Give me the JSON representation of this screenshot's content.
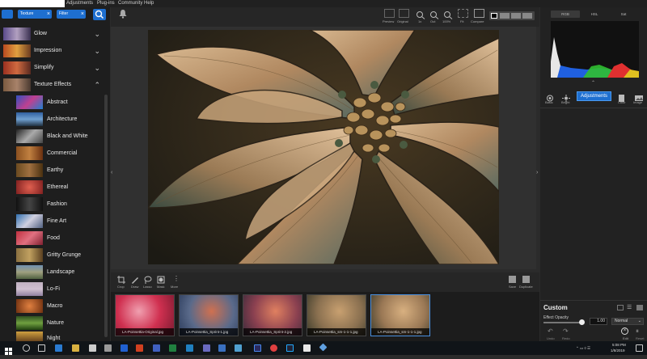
{
  "menubar": {
    "items": [
      "Adjustments",
      "Plug-ins",
      "Community",
      "Help"
    ]
  },
  "search": {
    "chips": [
      "Texture",
      "Filter"
    ]
  },
  "categories": [
    {
      "label": "Glow",
      "expanded": false
    },
    {
      "label": "Impression",
      "expanded": false
    },
    {
      "label": "Simplify",
      "expanded": false
    },
    {
      "label": "Texture Effects",
      "expanded": true
    }
  ],
  "presets": [
    "Abstract",
    "Architecture",
    "Black and White",
    "Commercial",
    "Earthy",
    "Ethereal",
    "Fashion",
    "Fine Art",
    "Food",
    "Gritty Grunge",
    "Landscape",
    "Lo-Fi",
    "Macro",
    "Nature",
    "Night"
  ],
  "toolbar": {
    "buttons": [
      "Preview",
      "Original",
      "1x",
      "Out",
      "100%",
      "Fit",
      "Compare",
      "Overlay"
    ],
    "left_bell": "bell"
  },
  "filmtools": {
    "left": [
      "Crop",
      "Draw",
      "Lasso",
      "Mask",
      "More"
    ],
    "right": [
      "Save",
      "Duplicate"
    ]
  },
  "thumbnails": [
    {
      "caption": "LA-Poinsettia-Original.jpg",
      "selected": false
    },
    {
      "caption": "LA-Poinsettia_Sprint-1.jpg",
      "selected": false
    },
    {
      "caption": "LA-Poinsettia_Sprint-2.jpg",
      "selected": false
    },
    {
      "caption": "LA-Poinsettia_sm-1-1-1.jpg",
      "selected": false
    },
    {
      "caption": "LA-Poinsettia_sm-1-1-1.jpg",
      "selected": true
    }
  ],
  "right_panel": {
    "tabs": [
      "RGB",
      "HSL",
      "Sat"
    ],
    "tools": [
      "Basic",
      "Bright",
      "Color",
      "Image"
    ],
    "adjustments_label": "Adjustments",
    "custom_title": "Custom",
    "effect_opacity_label": "Effect Opacity",
    "effect_opacity_value": "1.00",
    "blend_mode": "Normal",
    "bottom_buttons": [
      "Undo",
      "Redo",
      "Edit",
      "Reset"
    ]
  },
  "taskbar": {
    "time": "5:08 PM",
    "date": "1/8/2019"
  },
  "colors": {
    "accent": "#1e6fd0",
    "panel": "#1e1e1e",
    "canvas": "#303030"
  }
}
